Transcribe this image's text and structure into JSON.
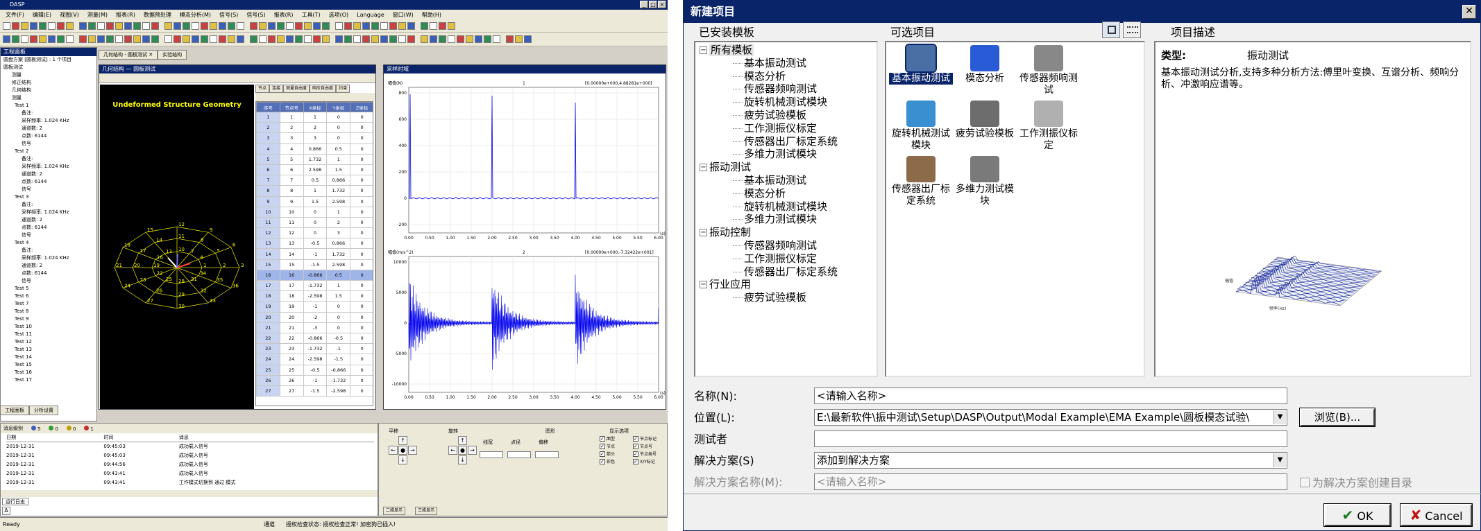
{
  "left_app": {
    "title": "DASP",
    "menu": [
      "文件(F)",
      "编辑(E)",
      "视图(V)",
      "测量(M)",
      "报表(R)",
      "数据预处理",
      "模态分析(M)",
      "信号(S)",
      "信号(S)",
      "报表(R)",
      "工具(T)",
      "选项(O)",
      "Language",
      "窗口(W)",
      "帮助(H)"
    ],
    "tree_header": "工程面板",
    "tree_items": [
      "圆盘方案 [圆板测试] : 1 个项目",
      "圆板测试",
      "测量",
      "修正结构",
      "几何结构",
      "测量",
      "Test 1",
      "备注:",
      "采样频率: 1.024 KHz",
      "通道数: 2",
      "点数: 6144",
      "信号",
      "Test 2",
      "备注:",
      "采样频率: 1.024 KHz",
      "通道数: 2",
      "点数: 6144",
      "信号",
      "Test 3",
      "备注:",
      "采样频率: 1.024 KHz",
      "通道数: 2",
      "点数: 6144",
      "信号",
      "Test 4",
      "备注:",
      "采样频率: 1.024 KHz",
      "通道数: 2",
      "点数: 6144",
      "信号",
      "Test 5",
      "Test 6",
      "Test 7",
      "Test 8",
      "Test 9",
      "Test 10",
      "Test 11",
      "Test 12",
      "Test 13",
      "Test 14",
      "Test 15",
      "Test 16",
      "Test 17"
    ],
    "tree_tabs": [
      "工程面板",
      "分析设置"
    ],
    "doc_tabs": [
      "几何结构 - 圆板测试 ✕",
      "实验结构"
    ],
    "geom_title": "几何结构 — 圆板测试",
    "plots_title": "采样时域",
    "geom_caption": "Undeformed Structure Geometry",
    "grid_tabs": [
      "节点",
      "连接",
      "测量自由度",
      "响应自由度",
      "约束"
    ],
    "grid_headers": [
      "序号",
      "节点号",
      "X坐标",
      "Y坐标",
      "Z坐标"
    ],
    "grid_rows": [
      [
        "1",
        "1",
        "1",
        "0",
        "0"
      ],
      [
        "2",
        "2",
        "2",
        "0",
        "0"
      ],
      [
        "3",
        "3",
        "3",
        "0",
        "0"
      ],
      [
        "4",
        "4",
        "0.866",
        "0.5",
        "0"
      ],
      [
        "5",
        "5",
        "1.732",
        "1",
        "0"
      ],
      [
        "6",
        "6",
        "2.598",
        "1.5",
        "0"
      ],
      [
        "7",
        "7",
        "0.5",
        "0.866",
        "0"
      ],
      [
        "8",
        "8",
        "1",
        "1.732",
        "0"
      ],
      [
        "9",
        "9",
        "1.5",
        "2.598",
        "0"
      ],
      [
        "10",
        "10",
        "0",
        "1",
        "0"
      ],
      [
        "11",
        "11",
        "0",
        "2",
        "0"
      ],
      [
        "12",
        "12",
        "0",
        "3",
        "0"
      ],
      [
        "13",
        "13",
        "-0.5",
        "0.866",
        "0"
      ],
      [
        "14",
        "14",
        "-1",
        "1.732",
        "0"
      ],
      [
        "15",
        "15",
        "-1.5",
        "2.598",
        "0"
      ],
      [
        "16",
        "16",
        "-0.866",
        "0.5",
        "0"
      ],
      [
        "17",
        "17",
        "-1.732",
        "1",
        "0"
      ],
      [
        "18",
        "18",
        "-2.598",
        "1.5",
        "0"
      ],
      [
        "19",
        "19",
        "-1",
        "0",
        "0"
      ],
      [
        "20",
        "20",
        "-2",
        "0",
        "0"
      ],
      [
        "21",
        "21",
        "-3",
        "0",
        "0"
      ],
      [
        "22",
        "22",
        "-0.866",
        "-0.5",
        "0"
      ],
      [
        "23",
        "23",
        "-1.732",
        "-1",
        "0"
      ],
      [
        "24",
        "24",
        "-2.598",
        "-1.5",
        "0"
      ],
      [
        "25",
        "25",
        "-0.5",
        "-0.866",
        "0"
      ],
      [
        "26",
        "26",
        "-1",
        "-1.732",
        "0"
      ],
      [
        "27",
        "27",
        "-1.5",
        "-2.598",
        "0"
      ]
    ],
    "plot1": {
      "label": "幅值(N)",
      "channel": "1",
      "range": "[0.00000e+000,4.88281e+000]",
      "yticks": [
        "800",
        "600",
        "400",
        "200",
        "0",
        "-200"
      ],
      "xticks": [
        "0.00",
        "0.50",
        "1.00",
        "1.50",
        "2.00",
        "2.50",
        "3.00",
        "3.50",
        "4.00",
        "4.50",
        "5.00",
        "5.50",
        "6.00"
      ],
      "unit": "(s)"
    },
    "plot2": {
      "label": "幅值(m/s^2)",
      "channel": "2",
      "range": "[0.00000e+000,-7.32422e+001]",
      "yticks": [
        "10000",
        "5000",
        "0",
        "-5000",
        "-10000"
      ],
      "xticks": [
        "0.00",
        "0.50",
        "1.00",
        "1.50",
        "2.00",
        "2.50",
        "3.00",
        "3.50",
        "4.00",
        "4.50",
        "5.00",
        "5.50",
        "6.00"
      ],
      "unit": "(s)"
    },
    "log_filter": "消息级别",
    "log_counts": [
      "5",
      "0",
      "0",
      "1"
    ],
    "log_headers": [
      "日期",
      "时间",
      "消息"
    ],
    "log_rows": [
      [
        "2019-12-31",
        "09:45:03",
        "成功载入信号"
      ],
      [
        "2019-12-31",
        "09:45:03",
        "成功载入信号"
      ],
      [
        "2019-12-31",
        "09:44:56",
        "成功载入信号"
      ],
      [
        "2019-12-31",
        "09:43:41",
        "成功载入信号"
      ],
      [
        "2019-12-31",
        "09:43:41",
        "工作模式切换到 通过 模式"
      ]
    ],
    "log_tab": "运行日志",
    "ctrl_groups": [
      "平移",
      "旋转",
      "图形",
      "显示选项"
    ],
    "ctrl_sliders": [
      "线宽",
      "点径",
      "偏移"
    ],
    "ctrl_opts": [
      "面型",
      "节点",
      "箭头",
      "彩色",
      "节点标记",
      "节点号",
      "节点类号",
      "X/Y标记"
    ],
    "ctrl_tabs": [
      "二维显示",
      "三维显示"
    ],
    "status": [
      "Ready",
      "通道",
      "授权检查状态: 授权检查正常! 加密狗已插入!"
    ]
  },
  "dialog": {
    "title": "新建项目",
    "sections": {
      "templates": "已安装模板",
      "projects": "可选项目",
      "desc": "项目描述"
    },
    "tree": [
      {
        "label": "所有模板",
        "level": 0,
        "toggle": "−",
        "selected": true
      },
      {
        "label": "基本振动测试",
        "level": 1
      },
      {
        "label": "模态分析",
        "level": 1
      },
      {
        "label": "传感器频响测试",
        "level": 1
      },
      {
        "label": "旋转机械测试模块",
        "level": 1
      },
      {
        "label": "疲劳试验模板",
        "level": 1
      },
      {
        "label": "工作测振仪标定",
        "level": 1
      },
      {
        "label": "传感器出厂标定系统",
        "level": 1
      },
      {
        "label": "多维力测试模块",
        "level": 1
      },
      {
        "label": "振动测试",
        "level": 0,
        "toggle": "−"
      },
      {
        "label": "基本振动测试",
        "level": 1
      },
      {
        "label": "模态分析",
        "level": 1
      },
      {
        "label": "旋转机械测试模块",
        "level": 1
      },
      {
        "label": "多维力测试模块",
        "level": 1
      },
      {
        "label": "振动控制",
        "level": 0,
        "toggle": "−"
      },
      {
        "label": "传感器频响测试",
        "level": 1
      },
      {
        "label": "工作测振仪标定",
        "level": 1
      },
      {
        "label": "传感器出厂标定系统",
        "level": 1
      },
      {
        "label": "行业应用",
        "level": 0,
        "toggle": "−"
      },
      {
        "label": "疲劳试验模板",
        "level": 1
      }
    ],
    "projects": [
      {
        "label": "基本振动测试",
        "icon": "hammer-icon",
        "selected": true,
        "color": "#4a6fa5"
      },
      {
        "label": "模态分析",
        "icon": "modal-analysis-icon",
        "color": "#2a5bd7"
      },
      {
        "label": "传感器频响测试",
        "icon": "sensor-icon",
        "color": "#888888"
      },
      {
        "label": "旋转机械测试模块",
        "icon": "rotation-icon",
        "color": "#3a8fd0"
      },
      {
        "label": "疲劳试验模板",
        "icon": "fatigue-icon",
        "color": "#6d6d6d"
      },
      {
        "label": "工作测振仪标定",
        "icon": "vibrometer-icon",
        "color": "#b0b0b0"
      },
      {
        "label": "传感器出厂标定系统",
        "icon": "calibration-icon",
        "color": "#8b6b4a"
      },
      {
        "label": "多维力测试模块",
        "icon": "force-sensor-icon",
        "color": "#7a7a7a"
      }
    ],
    "desc": {
      "type_label": "类型:",
      "type_value": "振动测试",
      "text": "基本振动测试分析,支持多种分析方法:傅里叶变换、互谱分析、频响分析、冲激响应谱等。",
      "chart_xlabel": "频率(Hz)",
      "chart_ylabel": "幅值"
    },
    "form": {
      "name_label": "名称(N):",
      "name_value": "<请输入名称>",
      "location_label": "位置(L):",
      "location_value": "E:\\最新软件\\振中测试\\Setup\\DASP\\Output\\Modal Example\\EMA Example\\圆板模态试验\\",
      "browse": "浏览(B)...",
      "tester_label": "测试者",
      "tester_value": "",
      "solution_label": "解决方案(S)",
      "solution_value": "添加到解决方案",
      "solution_name_label": "解决方案名称(M):",
      "solution_name_value": "<请输入名称>",
      "create_dir": "为解决方案创建目录"
    },
    "ok": "OK",
    "cancel": "Cancel"
  }
}
